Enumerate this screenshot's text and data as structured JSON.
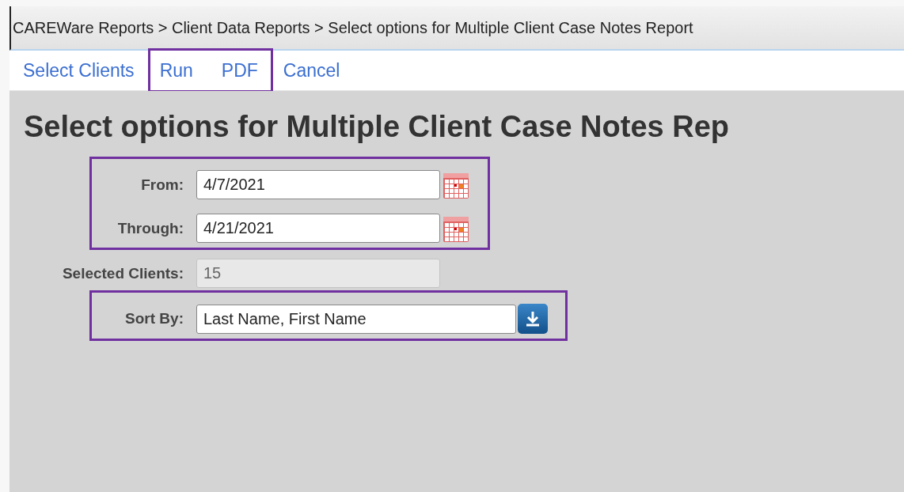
{
  "breadcrumb": "CAREWare Reports > Client Data Reports > Select options for Multiple Client Case Notes Report",
  "toolbar": [
    {
      "highlighted": false,
      "links": [
        "Select Clients"
      ]
    },
    {
      "highlighted": true,
      "links": [
        "Run",
        "PDF"
      ]
    },
    {
      "highlighted": false,
      "links": [
        "Cancel"
      ]
    }
  ],
  "title": "Select options for Multiple Client Case Notes Rep",
  "form_groups": [
    {
      "highlighted": true,
      "rows": [
        {
          "kind": "date",
          "label": "From:",
          "value": "4/7/2021"
        },
        {
          "kind": "date",
          "label": "Through:",
          "value": "4/21/2021"
        }
      ]
    },
    {
      "highlighted": false,
      "rows": [
        {
          "kind": "readonly",
          "label": "Selected Clients:",
          "value": "15"
        }
      ]
    },
    {
      "highlighted": true,
      "rows": [
        {
          "kind": "select",
          "label": "Sort By:",
          "value": "Last Name, First Name"
        }
      ]
    }
  ]
}
